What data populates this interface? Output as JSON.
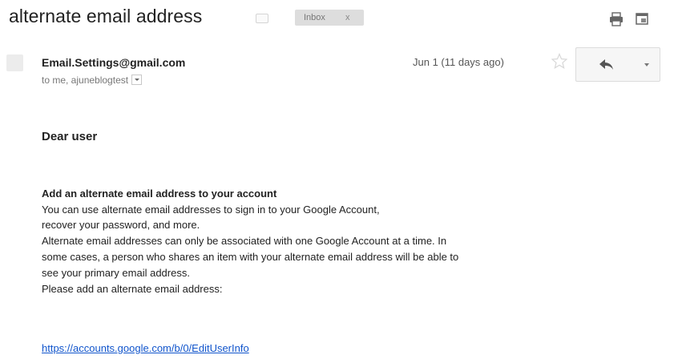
{
  "subject": "alternate email address",
  "label": {
    "text": "Inbox",
    "remove": "x"
  },
  "message": {
    "sender": "Email.Settings@gmail.com",
    "to_line": "to me, ajuneblogtest",
    "date": "Jun 1 (11 days ago)",
    "greeting": "Dear user",
    "heading": "Add an alternate email address to your account",
    "lines": [
      "You can use alternate email addresses to sign in to your Google Account,",
      "recover your password, and more.",
      "Alternate email addresses can only be associated with one Google Account at a time. In",
      "some cases, a person who shares an item with your alternate email address will be able to",
      "see your primary email address.",
      "Please add an alternate email address:"
    ],
    "link": "https://accounts.google.com/b/0/EditUserInfo"
  },
  "icons": [
    "label-tag-icon",
    "print-icon",
    "new-window-icon",
    "star-icon",
    "reply-icon",
    "chevron-down-icon",
    "avatar"
  ]
}
